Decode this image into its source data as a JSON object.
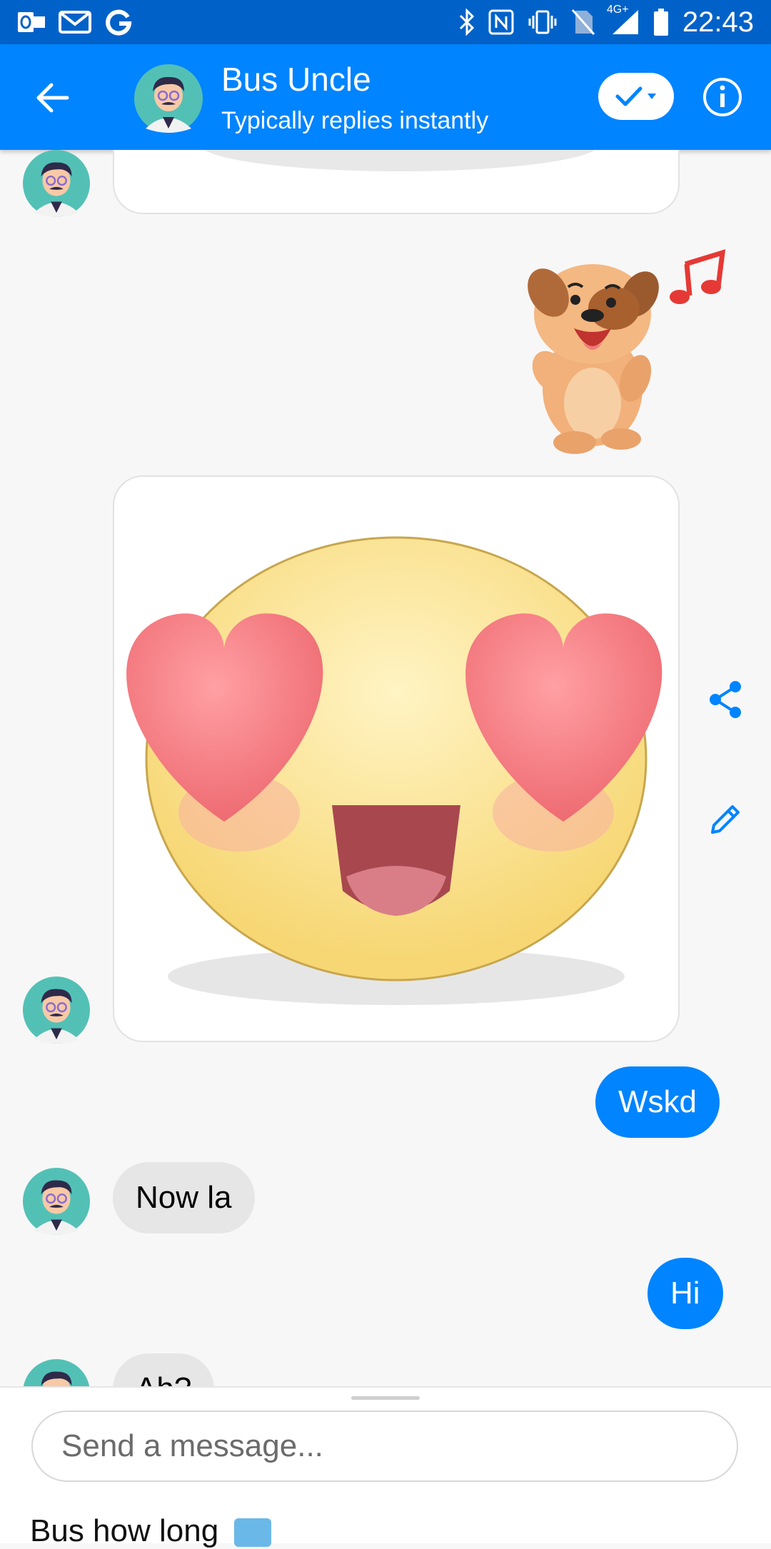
{
  "status_bar": {
    "time": "22:43",
    "network": "4G+"
  },
  "header": {
    "title": "Bus Uncle",
    "subtitle": "Typically replies instantly"
  },
  "messages": {
    "bubble_me_1": "Wskd",
    "bubble_them_1": "Now la",
    "bubble_me_2": "Hi",
    "bubble_them_2": "Ah?"
  },
  "composer": {
    "placeholder": "Send a message...",
    "quick_reply": "Bus how long"
  },
  "colors": {
    "status_bar": "#0062c8",
    "app_bar": "#0084ff",
    "accent": "#0084ff",
    "bubble_them": "#e6e6e6",
    "background": "#f7f7f7"
  },
  "icons": [
    "outlook-icon",
    "gmail-icon",
    "google-icon",
    "bluetooth-icon",
    "nfc-icon",
    "vibrate-icon",
    "no-sim-icon",
    "signal-icon",
    "battery-icon",
    "back-arrow-icon",
    "check-icon",
    "chevron-down-icon",
    "info-icon",
    "share-icon",
    "pencil-icon"
  ]
}
